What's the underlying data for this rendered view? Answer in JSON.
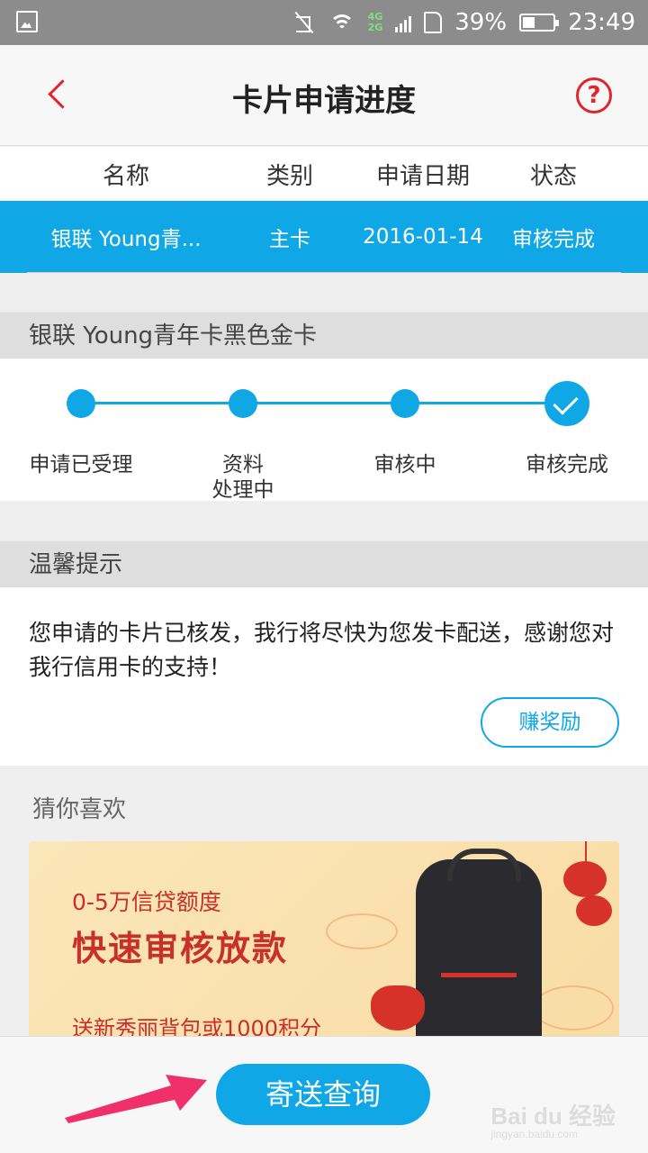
{
  "status_bar": {
    "network": [
      "4G",
      "2G"
    ],
    "battery_percent": "39%",
    "time": "23:49"
  },
  "header": {
    "title": "卡片申请进度"
  },
  "table": {
    "columns": [
      "名称",
      "类别",
      "申请日期",
      "状态"
    ],
    "rows": [
      {
        "name": "银联 Young青...",
        "type": "主卡",
        "date": "2016-01-14",
        "status": "审核完成"
      }
    ]
  },
  "card_section": {
    "title": "银联 Young青年卡黑色金卡",
    "steps": [
      "申请已受理",
      "资料\n处理中",
      "审核中",
      "审核完成"
    ]
  },
  "tips_section": {
    "title": "温馨提示",
    "message": "您申请的卡片已核发，我行将尽快为您发卡配送，感谢您对我行信用卡的支持！",
    "reward_button": "赚奖励"
  },
  "recommend": {
    "title": "猜你喜欢",
    "banner": {
      "subtitle": "0-5万信贷额度",
      "headline": "快速审核放款",
      "gift": "送新秀丽背包或1000积分"
    }
  },
  "footer": {
    "send_query_button": "寄送查询"
  },
  "watermark": {
    "brand": "Bai du 经验",
    "url": "jingyan.baidu.com"
  },
  "colors": {
    "accent": "#0fa7e6",
    "brand_red": "#e0262c",
    "banner_red": "#c9302c"
  }
}
